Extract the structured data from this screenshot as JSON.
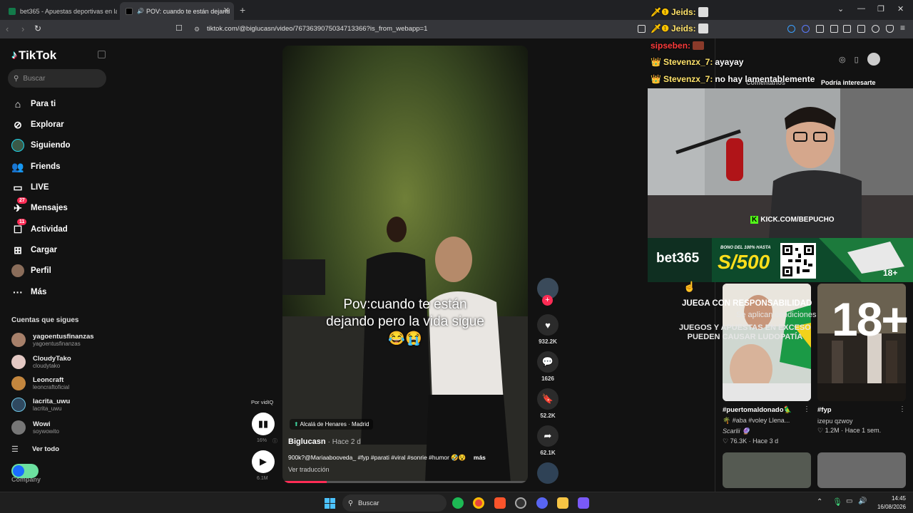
{
  "browser": {
    "tabs": [
      {
        "title": "bet365 - Apuestas deportivas en la r",
        "active": false
      },
      {
        "title": "POV: cuando te están dejand",
        "active": true
      }
    ],
    "url": "tiktok.com/@biglucasn/video/7673639075034713366?is_from_webapp=1"
  },
  "sidebar": {
    "logo": "TikTok",
    "search_placeholder": "Buscar",
    "nav": [
      {
        "label": "Para ti",
        "icon": "home-icon"
      },
      {
        "label": "Explorar",
        "icon": "compass-icon"
      },
      {
        "label": "Siguiendo",
        "icon": "following-avatar-icon"
      },
      {
        "label": "Friends",
        "icon": "friends-icon"
      },
      {
        "label": "LIVE",
        "icon": "live-icon"
      },
      {
        "label": "Mensajes",
        "icon": "messages-icon",
        "badge": "27"
      },
      {
        "label": "Actividad",
        "icon": "activity-icon",
        "badge": "11"
      },
      {
        "label": "Cargar",
        "icon": "upload-icon"
      },
      {
        "label": "Perfil",
        "icon": "profile-icon"
      },
      {
        "label": "Más",
        "icon": "more-icon"
      }
    ],
    "following_title": "Cuentas que sigues",
    "accounts": [
      {
        "name": "yagoentusfinanzas",
        "handle": "yagoentusfinanzas"
      },
      {
        "name": "CloudyTako",
        "handle": "cloudytako"
      },
      {
        "name": "Leoncraft",
        "handle": "leoncraftoficial"
      },
      {
        "name": "lacrita_uwu",
        "handle": "lacrita_uwu"
      },
      {
        "name": "Wowi",
        "handle": "soywowito"
      }
    ],
    "see_all": "Ver todo",
    "company": "Company"
  },
  "video": {
    "overlay_line1": "Pov:cuando te están",
    "overlay_line2": "dejando pero la vida sigue",
    "overlay_emoji": "😂😭",
    "location": "Alcalá de Henares · Madrid",
    "username": "Biglucasn",
    "time_ago": "· Hace 2 d",
    "description": "900k?@Mariaabooveda_ #fyp #parati #viral #sonrie #humor 🤣😵",
    "more": "más",
    "translate": "Ver traducción",
    "progress": 0.18,
    "likes": "932.2K",
    "comments": "1626",
    "saves": "52.2K",
    "shares": "62.1K",
    "vidiq_label": "Por vidIQ",
    "vidiq_percent": "16%",
    "vidiq_views": "6.1M"
  },
  "chat": [
    {
      "user": "Jeids:",
      "color": "#ffe36b",
      "badge": "🗡❶",
      "msg": ""
    },
    {
      "user": "Jeids:",
      "color": "#ffe36b",
      "badge": "🗡❶",
      "msg": ""
    },
    {
      "user": "sipseben:",
      "color": "#ff3b3b",
      "badge": "",
      "msg": ""
    },
    {
      "user": "Stevenzx_7:",
      "color": "#ffe36b",
      "badge": "👑",
      "msg": "ayayay"
    },
    {
      "user": "Stevenzx_7:",
      "color": "#ffe36b",
      "badge": "👑",
      "msg": "no hay lamentablemente"
    }
  ],
  "right_panel": {
    "tab_comments": "Comentarios",
    "tab_suggest": "Podría interesarte",
    "kick": "KICK.COM/BEPUCHO",
    "ad": {
      "brand": "bet365",
      "bono": "BONO DEL 100% HASTA",
      "amount": "S/500",
      "age": "18+",
      "warn1": "JUEGA CON RESPONSABILIDAD",
      "warn2": "Se aplican condiciones",
      "warn3a": "JUEGOS Y APUESTAS EN EXCESO",
      "warn3b": "PUEDEN CAUSAR LUDOPATÍA",
      "big_age": "18+"
    },
    "suggestions": [
      {
        "title": "#puertomaldonado🦜",
        "sub": "🌴 #aba #voley Llena...",
        "author": "Scarlii 🔮",
        "stats": "♡ 76.3K · Hace 3 d"
      },
      {
        "title": "#fyp",
        "sub": "izepu qzwoy",
        "author": "",
        "stats": "♡ 1.2M · Hace 1 sem."
      }
    ]
  },
  "taskbar": {
    "search": "Buscar",
    "time": "14:45",
    "date": "16/08/2026"
  }
}
